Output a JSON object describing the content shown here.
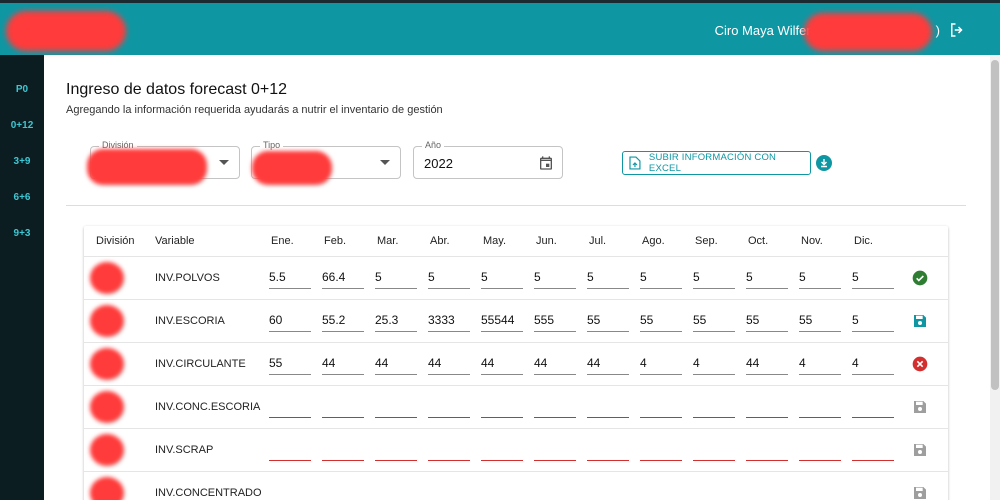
{
  "header": {
    "user_name": "Ciro Maya Wilfer (C",
    "user_suffix": ")"
  },
  "sidebar": {
    "items": [
      {
        "label": "P0"
      },
      {
        "label": "0+12"
      },
      {
        "label": "3+9"
      },
      {
        "label": "6+6"
      },
      {
        "label": "9+3"
      }
    ]
  },
  "page": {
    "title": "Ingreso de datos forecast 0+12",
    "subtitle": "Agregando la información requerida ayudarás a nutrir el inventario de gestión"
  },
  "filters": {
    "division_label": "División",
    "tipo_label": "Tipo",
    "anio_label": "Año",
    "anio_value": "2022"
  },
  "upload_button": "SUBIR INFORMACIÓN CON EXCEL",
  "table": {
    "headers": {
      "division": "División",
      "variable": "Variable",
      "months": [
        "Ene.",
        "Feb.",
        "Mar.",
        "Abr.",
        "May.",
        "Jun.",
        "Jul.",
        "Ago.",
        "Sep.",
        "Oct.",
        "Nov.",
        "Dic."
      ]
    },
    "rows": [
      {
        "variable": "INV.POLVOS",
        "values": [
          "5.5",
          "66.4",
          "5",
          "5",
          "5",
          "5",
          "5",
          "5",
          "5",
          "5",
          "5",
          "5"
        ],
        "status": "check-circle-icon"
      },
      {
        "variable": "INV.ESCORIA",
        "values": [
          "60",
          "55.2",
          "25.3",
          "3333",
          "55544",
          "555",
          "55",
          "55",
          "55",
          "55",
          "55",
          "5"
        ],
        "status": "save-icon"
      },
      {
        "variable": "INV.CIRCULANTE",
        "values": [
          "55",
          "44",
          "44",
          "44",
          "44",
          "44",
          "44",
          "4",
          "4",
          "44",
          "4",
          "4"
        ],
        "status": "error-circle-icon"
      },
      {
        "variable": "INV.CONC.ESCORIA",
        "values": [
          "",
          "",
          "",
          "",
          "",
          "",
          "",
          "",
          "",
          "",
          "",
          ""
        ],
        "status": "save-disabled-icon"
      },
      {
        "variable": "INV.SCRAP",
        "values": [
          "",
          "",
          "",
          "",
          "",
          "",
          "",
          "",
          "",
          "",
          "",
          ""
        ],
        "status": "save-disabled-icon"
      },
      {
        "variable": "INV.CONCENTRADO",
        "values": [
          "",
          "",
          "",
          "",
          "",
          "",
          "",
          "",
          "",
          "",
          "",
          ""
        ],
        "status": "save-disabled-icon"
      }
    ]
  },
  "colors": {
    "accent": "#0e97a3",
    "sidebar_bg": "#0b1d21",
    "success": "#2e7d32",
    "error": "#d32f2f",
    "disabled": "#9e9e9e"
  }
}
